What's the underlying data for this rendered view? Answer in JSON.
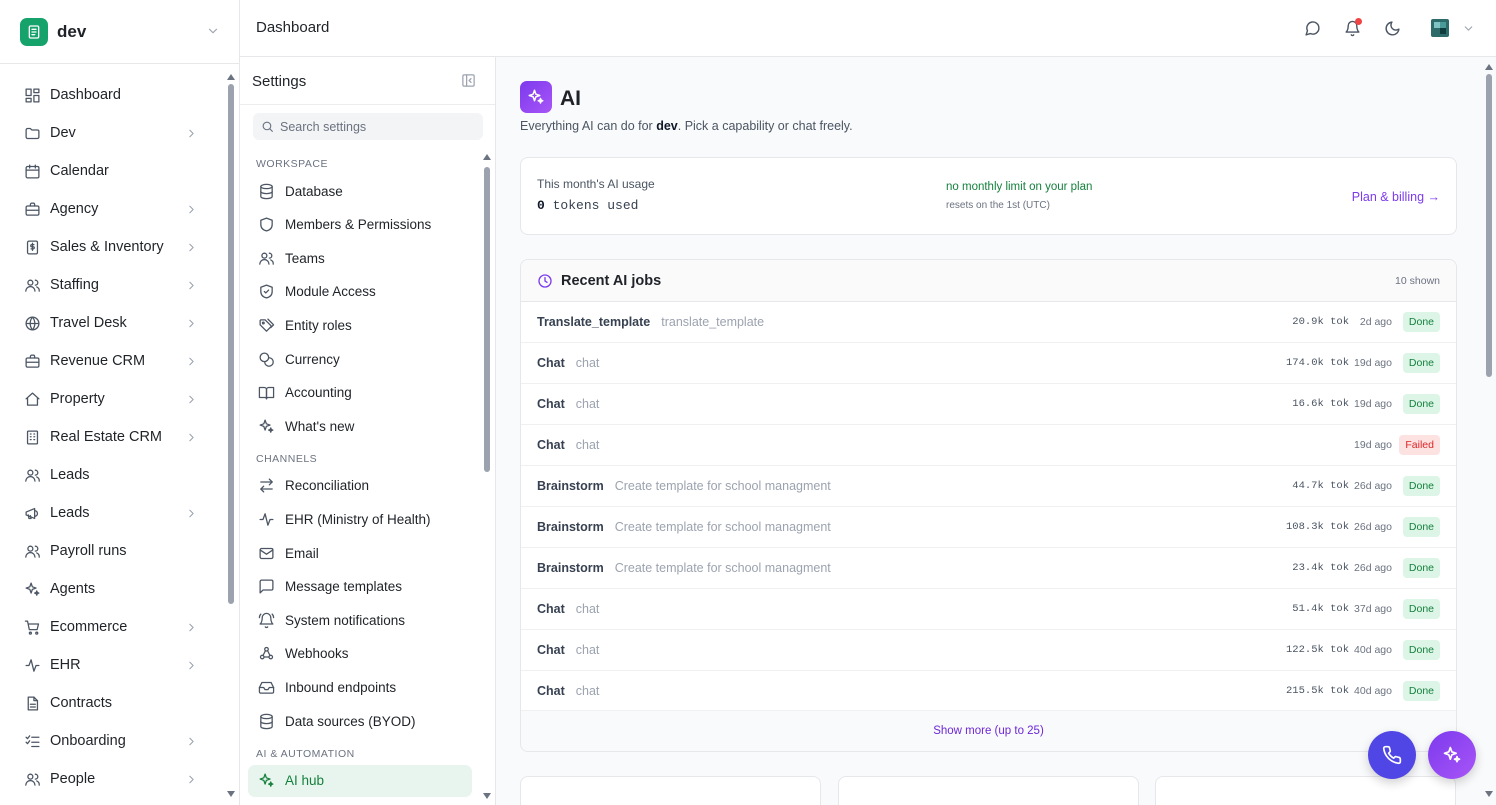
{
  "workspace": {
    "name": "dev"
  },
  "topbar": {
    "breadcrumb": "Dashboard"
  },
  "nav": {
    "items": [
      {
        "label": "Dashboard",
        "icon": "dashboard-icon",
        "chevron": false
      },
      {
        "label": "Dev",
        "icon": "folder-icon",
        "chevron": true
      },
      {
        "label": "Calendar",
        "icon": "calendar-icon",
        "chevron": false
      },
      {
        "label": "Agency",
        "icon": "briefcase-icon",
        "chevron": true
      },
      {
        "label": "Sales & Inventory",
        "icon": "dollar-receipt-icon",
        "chevron": true
      },
      {
        "label": "Staffing",
        "icon": "users-icon",
        "chevron": true
      },
      {
        "label": "Travel Desk",
        "icon": "globe-icon",
        "chevron": true
      },
      {
        "label": "Revenue CRM",
        "icon": "briefcase-icon",
        "chevron": true
      },
      {
        "label": "Property",
        "icon": "home-icon",
        "chevron": true
      },
      {
        "label": "Real Estate CRM",
        "icon": "building-icon",
        "chevron": true
      },
      {
        "label": "Leads",
        "icon": "users-icon",
        "chevron": false
      },
      {
        "label": "Leads",
        "icon": "megaphone-icon",
        "chevron": true
      },
      {
        "label": "Payroll runs",
        "icon": "users-icon",
        "chevron": false
      },
      {
        "label": "Agents",
        "icon": "sparkles-icon",
        "chevron": false
      },
      {
        "label": "Ecommerce",
        "icon": "cart-icon",
        "chevron": true
      },
      {
        "label": "EHR",
        "icon": "activity-icon",
        "chevron": true
      },
      {
        "label": "Contracts",
        "icon": "document-icon",
        "chevron": false
      },
      {
        "label": "Onboarding",
        "icon": "list-check-icon",
        "chevron": true
      },
      {
        "label": "People",
        "icon": "users-icon",
        "chevron": true
      }
    ]
  },
  "settings": {
    "title": "Settings",
    "search_placeholder": "Search settings",
    "sections": [
      {
        "title": "WORKSPACE",
        "items": [
          {
            "label": "Database",
            "icon": "database-icon"
          },
          {
            "label": "Members & Permissions",
            "icon": "shield-icon"
          },
          {
            "label": "Teams",
            "icon": "users-icon"
          },
          {
            "label": "Module Access",
            "icon": "shield-check-icon"
          },
          {
            "label": "Entity roles",
            "icon": "tags-icon"
          },
          {
            "label": "Currency",
            "icon": "coins-icon"
          },
          {
            "label": "Accounting",
            "icon": "book-open-icon"
          },
          {
            "label": "What's new",
            "icon": "sparkles-icon"
          }
        ]
      },
      {
        "title": "CHANNELS",
        "items": [
          {
            "label": "Reconciliation",
            "icon": "arrows-swap-icon"
          },
          {
            "label": "EHR (Ministry of Health)",
            "icon": "activity-icon"
          },
          {
            "label": "Email",
            "icon": "mail-icon"
          },
          {
            "label": "Message templates",
            "icon": "message-square-icon"
          },
          {
            "label": "System notifications",
            "icon": "bell-ring-icon"
          },
          {
            "label": "Webhooks",
            "icon": "webhook-icon"
          },
          {
            "label": "Inbound endpoints",
            "icon": "inbox-icon"
          },
          {
            "label": "Data sources (BYOD)",
            "icon": "database-icon"
          }
        ]
      },
      {
        "title": "AI & AUTOMATION",
        "items": [
          {
            "label": "AI hub",
            "icon": "sparkles-icon",
            "active": true
          }
        ]
      }
    ]
  },
  "page": {
    "title": "AI",
    "subtitle_pre": "Everything AI can do for ",
    "subtitle_bold": "dev",
    "subtitle_post": ". Pick a capability or chat freely."
  },
  "usage": {
    "label": "This month's AI usage",
    "value": "0",
    "unit": " tokens used",
    "limit_text": "no monthly limit on your plan",
    "reset_text": "resets on the 1st (UTC)",
    "link": "Plan & billing →"
  },
  "jobs": {
    "title": "Recent AI jobs",
    "count": "10 shown",
    "rows": [
      {
        "kind": "Translate_template",
        "desc": "translate_template",
        "tokens": "20.9k tok",
        "ago": "2d ago",
        "status": "Done"
      },
      {
        "kind": "Chat",
        "desc": "chat",
        "tokens": "174.0k tok",
        "ago": "19d ago",
        "status": "Done"
      },
      {
        "kind": "Chat",
        "desc": "chat",
        "tokens": "16.6k tok",
        "ago": "19d ago",
        "status": "Done"
      },
      {
        "kind": "Chat",
        "desc": "chat",
        "tokens": "",
        "ago": "19d ago",
        "status": "Failed"
      },
      {
        "kind": "Brainstorm",
        "desc": "Create template for school managment",
        "tokens": "44.7k tok",
        "ago": "26d ago",
        "status": "Done"
      },
      {
        "kind": "Brainstorm",
        "desc": "Create template for school managment",
        "tokens": "108.3k tok",
        "ago": "26d ago",
        "status": "Done"
      },
      {
        "kind": "Brainstorm",
        "desc": "Create template for school managment",
        "tokens": "23.4k tok",
        "ago": "26d ago",
        "status": "Done"
      },
      {
        "kind": "Chat",
        "desc": "chat",
        "tokens": "51.4k tok",
        "ago": "37d ago",
        "status": "Done"
      },
      {
        "kind": "Chat",
        "desc": "chat",
        "tokens": "122.5k tok",
        "ago": "40d ago",
        "status": "Done"
      },
      {
        "kind": "Chat",
        "desc": "chat",
        "tokens": "215.5k tok",
        "ago": "40d ago",
        "status": "Done"
      }
    ],
    "show_more": "Show more (up to 25)"
  },
  "colors": {
    "brand": "#16a36b",
    "accent": "#7c3aed",
    "done": "#15803d",
    "failed": "#dc2626"
  }
}
